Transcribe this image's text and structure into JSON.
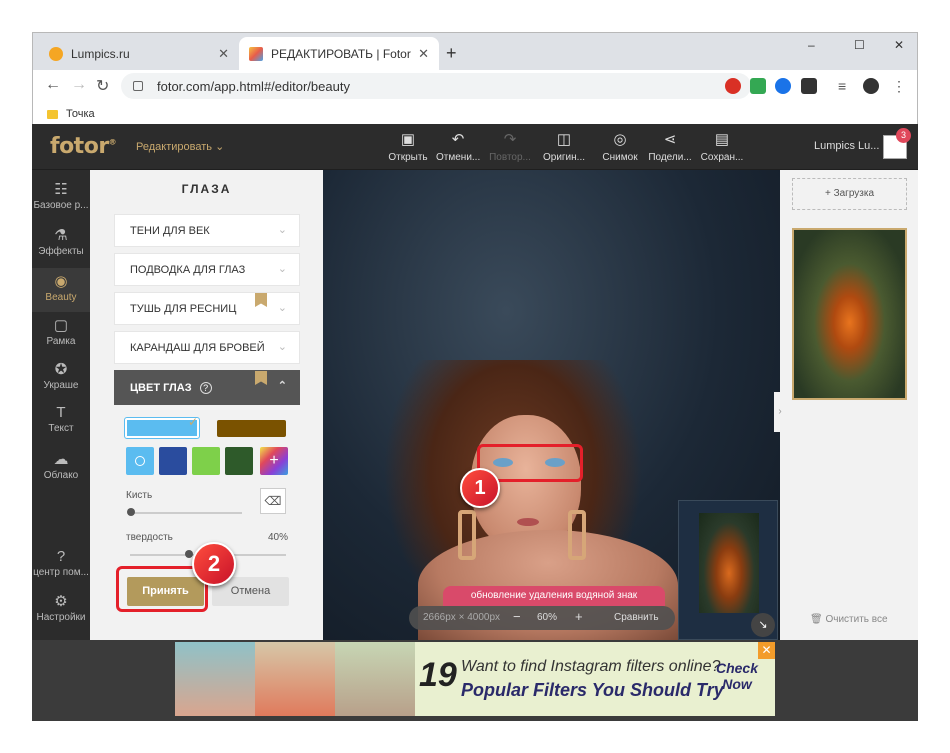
{
  "browser": {
    "tabs": [
      {
        "label": "Lumpics.ru",
        "favicon_color": "#f5a623"
      },
      {
        "label": "РЕДАКТИРОВАТЬ | Fotor",
        "favicon_color": "#e85d4a"
      }
    ],
    "new_tab": "+",
    "url": "fotor.com/app.html#/editor/beauty",
    "bookmark": "Точка",
    "window_controls": [
      "–",
      "☐",
      "✕"
    ]
  },
  "app": {
    "logo": "fotor",
    "logo_mark": "®",
    "mode": "Редактировать",
    "tools": [
      {
        "label": "Открыть",
        "icon": "image-icon"
      },
      {
        "label": "Отмени...",
        "icon": "undo-icon"
      },
      {
        "label": "Повтор...",
        "icon": "redo-icon"
      },
      {
        "label": "Оригин...",
        "icon": "compare-icon"
      },
      {
        "label": "Снимок",
        "icon": "camera-icon"
      },
      {
        "label": "Подели...",
        "icon": "share-icon"
      },
      {
        "label": "Сохран...",
        "icon": "save-icon"
      }
    ],
    "user": "Lumpics Lu...",
    "notifications": "3"
  },
  "sidebar": [
    {
      "label": "Базовое р...",
      "icon": "sliders-icon"
    },
    {
      "label": "Эффекты",
      "icon": "flask-icon"
    },
    {
      "label": "Beauty",
      "icon": "eye-icon"
    },
    {
      "label": "Рамка",
      "icon": "frame-icon"
    },
    {
      "label": "Украше",
      "icon": "sticker-icon"
    },
    {
      "label": "Текст",
      "icon": "text-icon"
    },
    {
      "label": "Облако",
      "icon": "cloud-icon"
    },
    {
      "label": "центр пом...",
      "icon": "help-icon"
    },
    {
      "label": "Настройки",
      "icon": "gear-icon"
    }
  ],
  "panel": {
    "title": "ГЛАЗА",
    "items": [
      "ТЕНИ ДЛЯ ВЕК",
      "ПОДВОДКА ДЛЯ ГЛАЗ",
      "ТУШЬ ДЛЯ РЕСНИЦ",
      "КАРАНДАШ ДЛЯ БРОВЕЙ"
    ],
    "open_item": "ЦВЕТ ГЛАЗ",
    "colors": [
      "#5bbcf0",
      "#7a5200",
      "#2a4c9e",
      "#7ed04a",
      "#2e5a2a"
    ],
    "brush_label": "Кисть",
    "brush_value": 0,
    "hardness_label": "твердость",
    "hardness_value": "40%",
    "accept": "Принять",
    "cancel": "Отмена"
  },
  "canvas": {
    "watermark_text": "обновление удаления водяной знак",
    "dimensions": "2666px × 4000px",
    "zoom": "60%",
    "minus": "−",
    "plus": "+",
    "compare": "Сравнить"
  },
  "right": {
    "upload": "Загрузка",
    "clear_all": "Очистить все"
  },
  "ad": {
    "line1": "Want to find Instagram filters online?",
    "number": "19",
    "line2": "Popular Filters You Should Try",
    "cta": "Check Now"
  },
  "callouts": [
    "1",
    "2"
  ]
}
